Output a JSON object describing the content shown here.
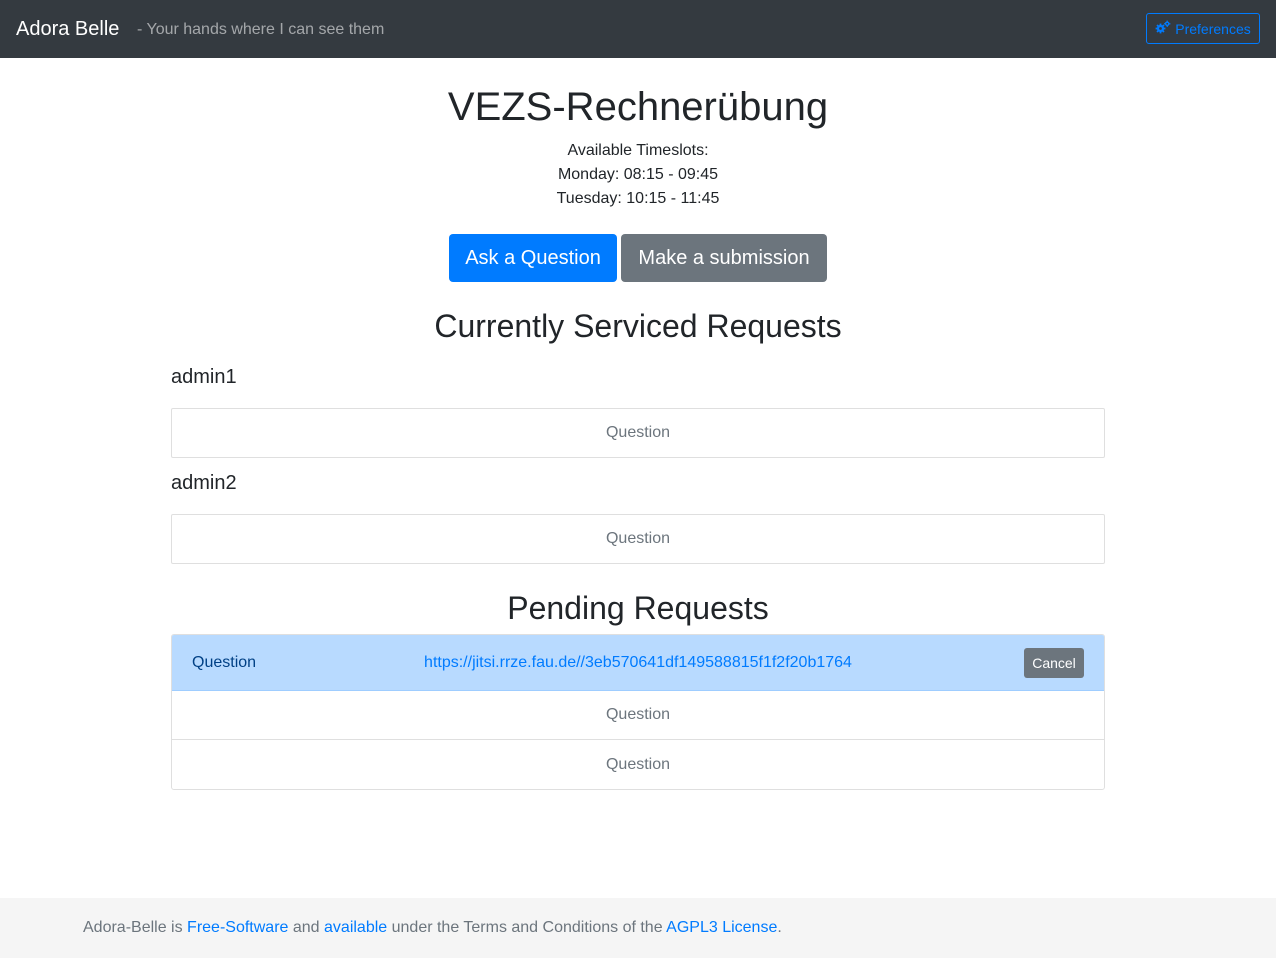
{
  "navbar": {
    "brand": "Adora Belle",
    "tagline": "- Your hands where I can see them",
    "preferences_label": "Preferences",
    "preferences_icon": "gears-icon"
  },
  "course": {
    "title": "VEZS-Rechnerübung",
    "timeslots_heading": "Available Timeslots:",
    "timeslots": [
      "Monday: 08:15 - 09:45",
      "Tuesday: 10:15 - 11:45"
    ]
  },
  "actions": {
    "ask_label": "Ask a Question",
    "submit_label": "Make a submission"
  },
  "serviced": {
    "heading": "Currently Serviced Requests",
    "tutors": [
      {
        "name": "admin1",
        "request": "Question"
      },
      {
        "name": "admin2",
        "request": "Question"
      }
    ]
  },
  "pending": {
    "heading": "Pending Requests",
    "own_request": {
      "type": "Question",
      "link": "https://jitsi.rrze.fau.de//3eb570641df149588815f1f2f20b1764",
      "cancel_label": "Cancel"
    },
    "others": [
      "Question",
      "Question"
    ]
  },
  "footer": {
    "part1": "Adora-Belle is ",
    "link_free_software": "Free-Software",
    "part2": " and ",
    "link_available": "available",
    "part3": " under the Terms and Conditions of the ",
    "link_license": "AGPL3 License",
    "part4": "."
  },
  "colors": {
    "navbar_bg": "#343a40",
    "primary": "#007bff",
    "secondary": "#6c757d",
    "active_row_bg": "#b8daff",
    "footer_bg": "#f5f5f5"
  }
}
